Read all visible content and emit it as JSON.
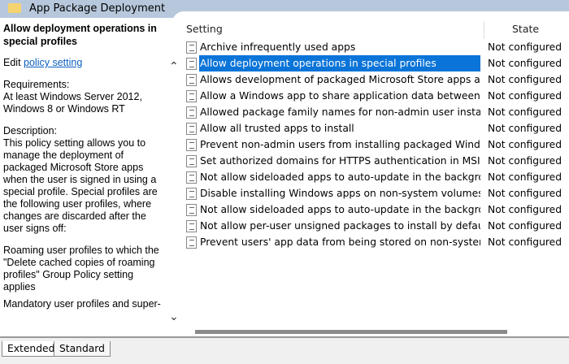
{
  "window": {
    "title": "App Package Deployment"
  },
  "description": {
    "heading": "Allow deployment operations in special profiles",
    "edit_prefix": "Edit",
    "edit_link": "policy setting",
    "requirements": "Requirements:\nAt least Windows Server 2012, Windows 8 or Windows RT",
    "desc_label": "Description:",
    "desc_text": "This policy setting allows you to manage the deployment of packaged Microsoft Store apps when the user is signed in using a special profile. Special profiles are the following user profiles, where changes are discarded after the user signs off:",
    "roaming": "Roaming user profiles to which the \"Delete cached copies of roaming profiles\" Group Policy setting applies",
    "mandatory": "Mandatory user profiles and super-"
  },
  "list": {
    "columns": {
      "setting": "Setting",
      "state": "State"
    },
    "rows": [
      {
        "name": "Archive infrequently used apps",
        "state": "Not configured"
      },
      {
        "name": "Allow deployment operations in special profiles",
        "state": "Not configured",
        "selected": true
      },
      {
        "name": "Allows development of packaged Microsoft Store apps and i...",
        "state": "Not configured"
      },
      {
        "name": "Allow a Windows app to share application data between users",
        "state": "Not configured"
      },
      {
        "name": "Allowed package family names for non-admin user install",
        "state": "Not configured"
      },
      {
        "name": "Allow all trusted apps to install",
        "state": "Not configured"
      },
      {
        "name": "Prevent non-admin users from installing packaged Windows ...",
        "state": "Not configured"
      },
      {
        "name": "Set authorized domains for HTTPS authentication in MSIX str...",
        "state": "Not configured"
      },
      {
        "name": "Not allow sideloaded apps to auto-update in the background",
        "state": "Not configured"
      },
      {
        "name": "Disable installing Windows apps on non-system volumes",
        "state": "Not configured"
      },
      {
        "name": "Not allow sideloaded apps to auto-update in the background",
        "state": "Not configured"
      },
      {
        "name": "Not allow per-user unsigned packages to install by default (r...",
        "state": "Not configured"
      },
      {
        "name": "Prevent users' app data from being stored on non-system vo...",
        "state": "Not configured"
      }
    ]
  },
  "tabs": {
    "extended": "Extended",
    "standard": "Standard"
  }
}
